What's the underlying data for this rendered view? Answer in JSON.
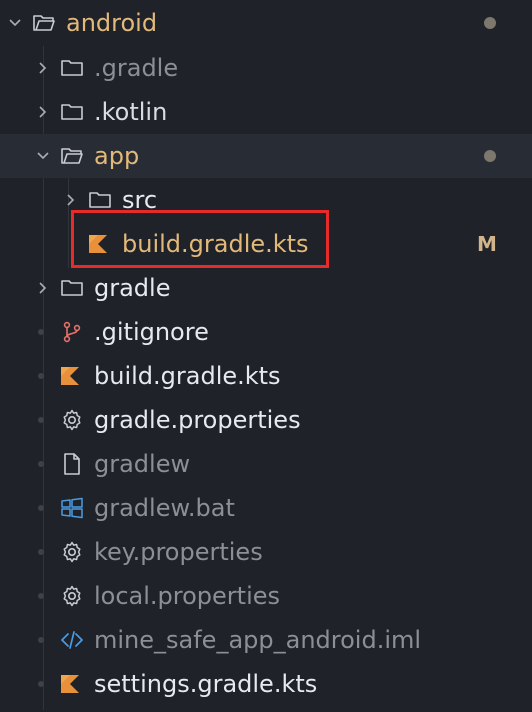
{
  "explorer": {
    "root": {
      "label": "android",
      "modified": true
    },
    "items": [
      {
        "label": ".gradle",
        "kind": "folder",
        "icon": "folder-icon",
        "state": "collapsed"
      },
      {
        "label": ".kotlin",
        "kind": "folder",
        "icon": "folder-icon",
        "state": "collapsed"
      },
      {
        "label": "app",
        "kind": "folder",
        "icon": "folder-open-icon",
        "state": "expanded",
        "modified": true
      },
      {
        "label": "src",
        "kind": "folder",
        "icon": "folder-icon",
        "state": "collapsed"
      },
      {
        "label": "build.gradle.kts",
        "kind": "file",
        "icon": "kotlin-icon",
        "status": "M",
        "highlighted": true
      },
      {
        "label": "gradle",
        "kind": "folder",
        "icon": "folder-icon",
        "state": "collapsed"
      },
      {
        "label": ".gitignore",
        "kind": "file",
        "icon": "git-icon"
      },
      {
        "label": "build.gradle.kts",
        "kind": "file",
        "icon": "kotlin-icon"
      },
      {
        "label": "gradle.properties",
        "kind": "file",
        "icon": "gear-icon"
      },
      {
        "label": "gradlew",
        "kind": "file",
        "icon": "file-icon"
      },
      {
        "label": "gradlew.bat",
        "kind": "file",
        "icon": "windows-icon"
      },
      {
        "label": "key.properties",
        "kind": "file",
        "icon": "gear-icon"
      },
      {
        "label": "local.properties",
        "kind": "file",
        "icon": "gear-icon"
      },
      {
        "label": "mine_safe_app_android.iml",
        "kind": "file",
        "icon": "code-icon"
      },
      {
        "label": "settings.gradle.kts",
        "kind": "file",
        "icon": "kotlin-icon"
      }
    ]
  },
  "colors": {
    "background": "#1f2228",
    "modified_text": "#e2b97a",
    "highlight_box": "#e82a2a",
    "kotlin_icon": "#e8913a",
    "windows_icon": "#4a9be3",
    "code_icon": "#4a9be3",
    "git_icon": "#e8726a"
  }
}
